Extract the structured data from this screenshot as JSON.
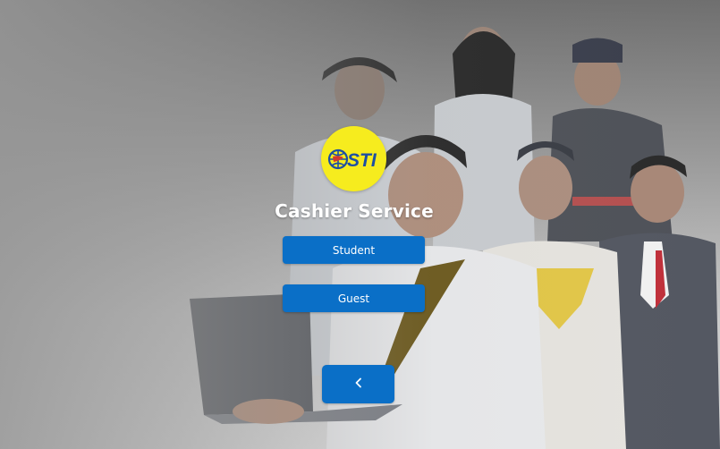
{
  "app": {
    "title": "Cashier Service",
    "logo_text": "STI"
  },
  "actions": {
    "student_label": "Student",
    "guest_label": "Guest",
    "back_icon": "chevron-left-icon"
  },
  "colors": {
    "button": "#0a6fc7",
    "logo_bg": "#f6ec1e",
    "logo_text": "#1d4fa3",
    "title_text": "#ffffff"
  }
}
